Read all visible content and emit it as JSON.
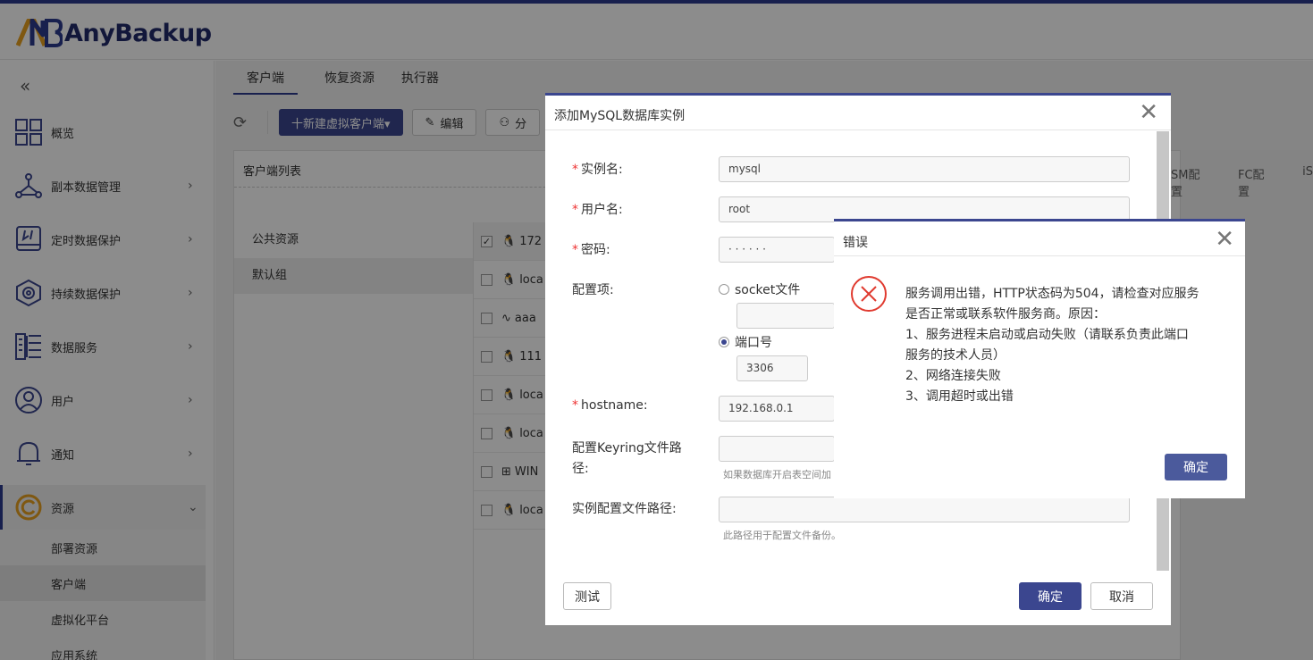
{
  "app": {
    "logo_text": "AnyBackup"
  },
  "sidebar": {
    "collapse_glyph": "«",
    "items": [
      {
        "label": "概览",
        "icon": "dashboard-icon"
      },
      {
        "label": "副本数据管理",
        "icon": "copy-data-icon"
      },
      {
        "label": "定时数据保护",
        "icon": "scheduled-protect-icon"
      },
      {
        "label": "持续数据保护",
        "icon": "continuous-protect-icon"
      },
      {
        "label": "数据服务",
        "icon": "data-service-icon"
      },
      {
        "label": "用户",
        "icon": "user-icon"
      },
      {
        "label": "通知",
        "icon": "bell-icon"
      },
      {
        "label": "资源",
        "icon": "resource-icon"
      }
    ],
    "sub_items": [
      "部署资源",
      "客户端",
      "虚拟化平台",
      "应用系统"
    ]
  },
  "main": {
    "tabs": [
      "客户端",
      "恢复资源",
      "执行器"
    ],
    "toolbar": {
      "new_virtual_client": "十新建虚拟客户端▾",
      "edit": "编辑",
      "share": "分"
    },
    "panel_title": "客户端列表",
    "groups": [
      "公共资源",
      "默认组"
    ],
    "clients": [
      "172",
      "loca",
      "aaa",
      "111",
      "loca",
      "loca",
      "WIN",
      "loca"
    ],
    "right_tabs": [
      "SM配置",
      "FC配置",
      "iS"
    ]
  },
  "dialog": {
    "title": "添加MySQL数据库实例",
    "fields": {
      "instance_name_label": "实例名:",
      "instance_name_value": "mysql",
      "username_label": "用户名:",
      "username_value": "root",
      "password_label": "密码:",
      "password_value": "· · · · · ·",
      "config_label": "配置项:",
      "socket_label": "socket文件",
      "port_label": "端口号",
      "port_value": "3306",
      "hostname_label": "hostname:",
      "hostname_value": "192.168.0.1",
      "keyring_label": "配置Keyring文件路径:",
      "keyring_hint": "如果数据库开启表空间加",
      "config_path_label": "实例配置文件路径:",
      "config_path_hint": "此路径用于配置文件备份。"
    },
    "buttons": {
      "test": "测试",
      "ok": "确定",
      "cancel": "取消"
    }
  },
  "error_dialog": {
    "title": "错误",
    "message_lines": [
      "服务调用出错，HTTP状态码为504，请检查对应服务",
      "是否正常或联系软件服务商。原因：",
      "1、服务进程未启动或启动失败（请联系负责此端口",
      "服务的技术人员）",
      "2、网络连接失败",
      "3、调用超时或出错"
    ],
    "ok": "确定"
  },
  "colors": {
    "brand": "#2d3b8e",
    "button": "#3b468f",
    "error": "#e03a2f"
  }
}
